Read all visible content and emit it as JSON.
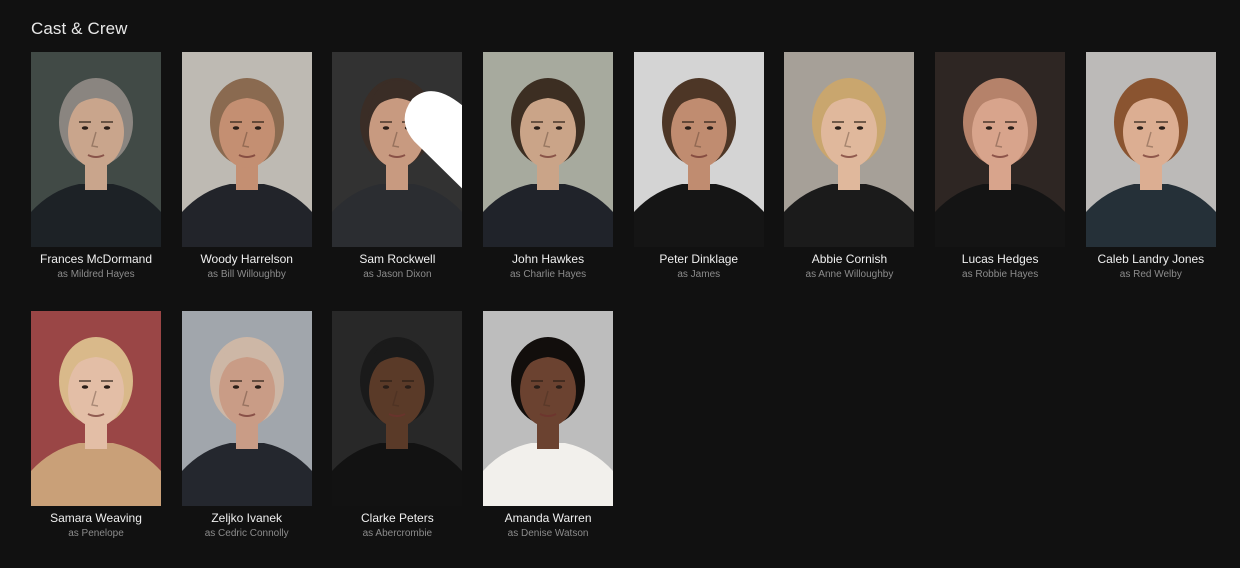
{
  "section": {
    "title": "Cast & Crew"
  },
  "cast": [
    {
      "name": "Frances McDormand",
      "role": "as Mildred Hayes",
      "bg": "#4a5550",
      "skin": "#c9a58c",
      "hair": "#8a8580",
      "shirt": "#1d2226"
    },
    {
      "name": "Woody Harrelson",
      "role": "as Bill Willoughby",
      "bg": "#d9d4cc",
      "skin": "#c48f72",
      "hair": "#8a6a50",
      "shirt": "#22242a"
    },
    {
      "name": "Sam Rockwell",
      "role": "as Jason Dixon",
      "bg": "#3a3a3a",
      "skin": "#c89a80",
      "hair": "#3a2d26",
      "shirt": "#2b2d31"
    },
    {
      "name": "John Hawkes",
      "role": "as Charlie Hayes",
      "bg": "#bfc2b4",
      "skin": "#caa488",
      "hair": "#3c2e22",
      "shirt": "#20232a"
    },
    {
      "name": "Peter Dinklage",
      "role": "as James",
      "bg": "#f2f2f2",
      "skin": "#c08c70",
      "hair": "#4d3626",
      "shirt": "#151515"
    },
    {
      "name": "Abbie Cornish",
      "role": "as Anne Willoughby",
      "bg": "#bdb7ad",
      "skin": "#e0b89c",
      "hair": "#c9a66e",
      "shirt": "#1b1b1b"
    },
    {
      "name": "Lucas Hedges",
      "role": "as Robbie Hayes",
      "bg": "#352c28",
      "skin": "#d8a48c",
      "hair": "#b5826a",
      "shirt": "#141414"
    },
    {
      "name": "Caleb Landry Jones",
      "role": "as Red Welby",
      "bg": "#d6d4d2",
      "skin": "#dcae92",
      "hair": "#8a5430",
      "shirt": "#253038"
    },
    {
      "name": "Samara Weaving",
      "role": "as Penelope",
      "bg": "#b05050",
      "skin": "#e3bea6",
      "hair": "#d9b98a",
      "shirt": "#c9a078"
    },
    {
      "name": "Zeljko Ivanek",
      "role": "as Cedric Connolly",
      "bg": "#b8bdc4",
      "skin": "#c99c86",
      "hair": "#cdb7a6",
      "shirt": "#24272e"
    },
    {
      "name": "Clarke Peters",
      "role": "as Abercrombie",
      "bg": "#2e2e2e",
      "skin": "#5a3a28",
      "hair": "#1a1a1a",
      "shirt": "#121212"
    },
    {
      "name": "Amanda Warren",
      "role": "as Denise Watson",
      "bg": "#d8d8d8",
      "skin": "#6b4230",
      "hair": "#120e0c",
      "shirt": "#f2f0ec"
    }
  ],
  "hover": {
    "index": 2,
    "favorite_icon": "heart-icon",
    "more_icon": "more-options-icon"
  },
  "colors": {
    "background": "#111111",
    "name_text": "#f0f0f0",
    "role_text": "#8c8c8c"
  }
}
